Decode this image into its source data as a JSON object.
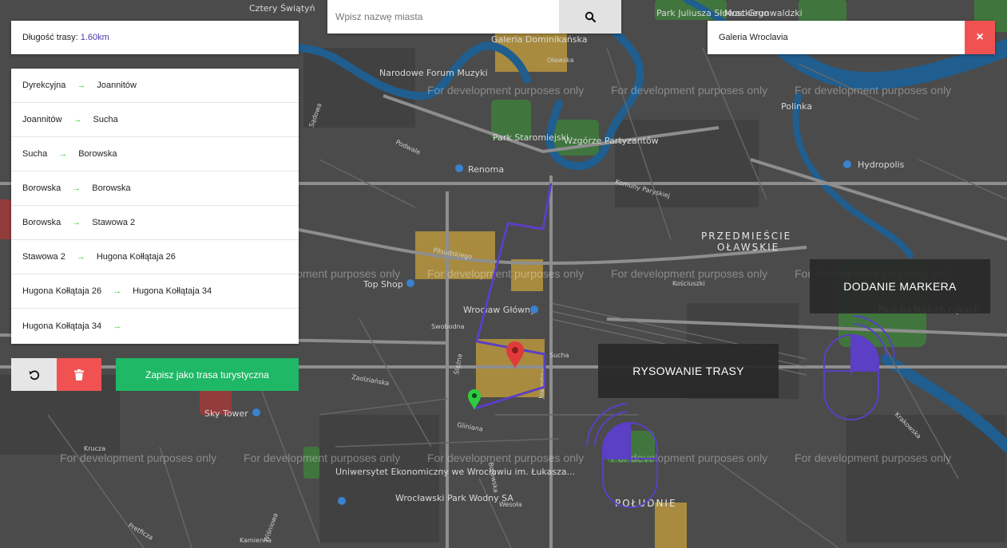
{
  "route_length": {
    "label": "Długość trasy:",
    "value": "1.60km"
  },
  "search": {
    "placeholder": "Wpisz nazwę miasta",
    "value": ""
  },
  "place": {
    "name": "Galeria Wroclavia",
    "close_label": "×"
  },
  "route_legs": [
    {
      "from": "Dyrekcyjna",
      "arrow": "→",
      "to": "Joannitów"
    },
    {
      "from": "Joannitów",
      "arrow": "→",
      "to": "Sucha"
    },
    {
      "from": "Sucha",
      "arrow": "→",
      "to": "Borowska"
    },
    {
      "from": "Borowska",
      "arrow": "→",
      "to": "Borowska"
    },
    {
      "from": "Borowska",
      "arrow": "→",
      "to": "Stawowa 2"
    },
    {
      "from": "Stawowa 2",
      "arrow": "→",
      "to": "Hugona Kołłątaja 26"
    },
    {
      "from": "Hugona Kołłątaja 26",
      "arrow": "→",
      "to": "Hugona Kołłątaja 34"
    },
    {
      "from": "Hugona Kołłątaja 34",
      "arrow": "→",
      "to": ""
    }
  ],
  "actions": {
    "undo_icon": "undo-icon",
    "delete_icon": "trash-icon",
    "save_label": "Zapisz jako trasa turystyczna"
  },
  "hints": {
    "draw_route": "RYSOWANIE TRASY",
    "add_marker": "DODANIE MARKERA"
  },
  "map": {
    "watermark": "For development purposes only",
    "places": {
      "dominikanska": "Galeria Dominikańska",
      "forum": "Narodowe Forum Muzyki",
      "staromiejski": "Park Staromiejski",
      "partyzantow": "Wzgórze Partyzantów",
      "renoma": "Renoma",
      "hydropolis": "Hydropolis",
      "polinka": "Polinka",
      "przedmiescie_1": "PRZEDMIEŚCIE",
      "przedmiescie_2": "OŁAWSKIE",
      "topshop": "Top Shop",
      "glowny": "Wrocław Główny",
      "skytower": "Sky Tower",
      "poludnie": "POŁUDNIE",
      "parkwodny": "Wrocławski Park Wodny SA",
      "ue": "Uniwersytet Ekonomiczny we Wrocławiu im. Łukasza...",
      "niskie": "Park na Niskich Łąkach",
      "grunwaldzki": "Most Grunwaldzki",
      "slowacki": "Park Juliusza Słowackiego",
      "cztery": "Cztery Świątyń"
    },
    "streets": [
      "Piłsudskiego",
      "Swobodna",
      "Sucha",
      "Gliniana",
      "Borowska",
      "Ślężna",
      "Kościuszki",
      "Podwale",
      "Oławska",
      "Krakowska",
      "Dyrekcyjna",
      "Joannitów",
      "Sądowa",
      "Zaolziańska",
      "Krucza",
      "Kamienna",
      "Wesoła",
      "Pretficza",
      "Komuny Paryskiej",
      "Wiśniowa"
    ],
    "accent": "#5b3fc4",
    "start_color": "#2ecc40",
    "end_color": "#e03a3a"
  }
}
